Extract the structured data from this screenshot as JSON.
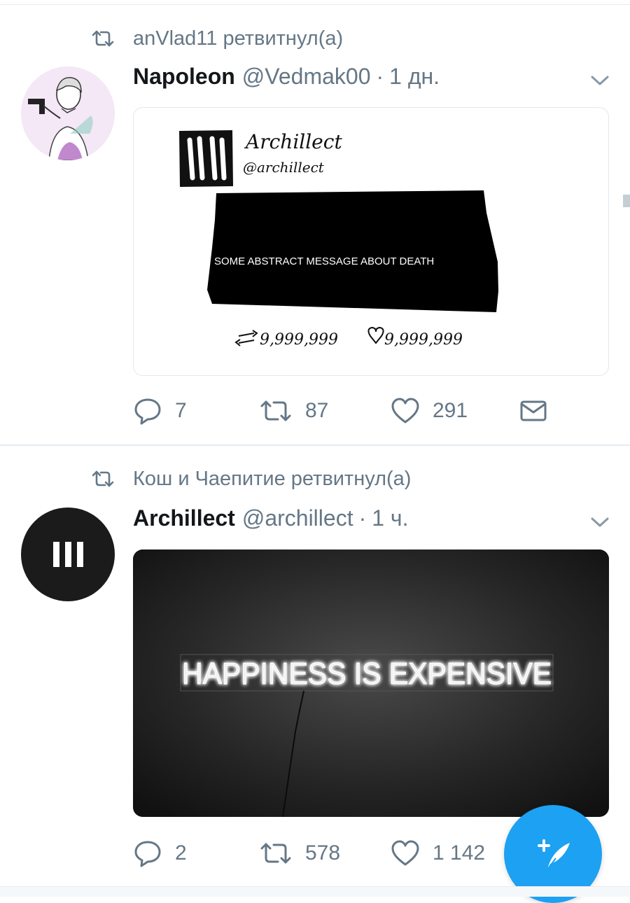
{
  "tweets": [
    {
      "retweeted_by": "anVlad11 ретвитнул(а)",
      "author_name": "Napoleon",
      "author_handle": "@Vedmak00",
      "separator": "·",
      "time": "1 дн.",
      "quoted_image": {
        "account_name": "Archillect",
        "account_handle": "@archillect",
        "redacted_text": "SOME ABSTRACT MESSAGE ABOUT DEATH",
        "retweets": "9,999,999",
        "likes": "9,999,999"
      },
      "actions": {
        "replies": "7",
        "retweets": "87",
        "likes": "291"
      }
    },
    {
      "retweeted_by": "Кош и Чаепитие ретвитнул(а)",
      "author_name": "Archillect",
      "author_handle": "@archillect",
      "separator": "·",
      "time": "1 ч.",
      "image": {
        "neon_text": "HAPPINESS IS EXPENSIVE"
      },
      "actions": {
        "replies": "2",
        "retweets": "578",
        "likes": "1 142"
      }
    }
  ],
  "colors": {
    "accent": "#1da1f2",
    "secondary_text": "#657786",
    "primary_text": "#14171a",
    "divider": "#e6ecf0"
  },
  "icons": [
    "retweet-icon",
    "caret-down-icon",
    "reply-icon",
    "like-icon",
    "dm-icon",
    "compose-tweet-icon"
  ]
}
